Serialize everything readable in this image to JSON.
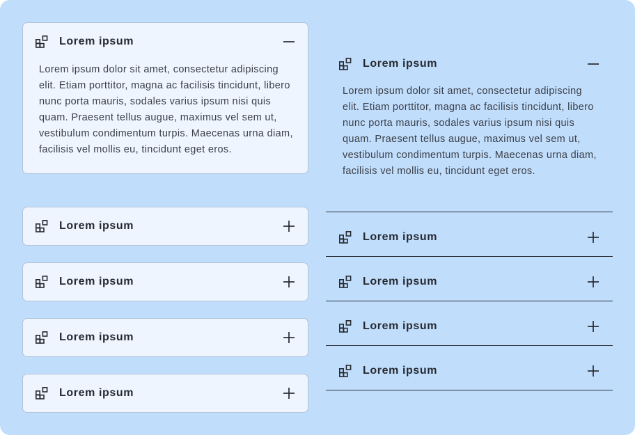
{
  "left_accordion": {
    "items": [
      {
        "title": "Lorem ipsum",
        "expanded": true,
        "toggle_icon": "minus-icon",
        "leading_icon": "widgets-icon",
        "content": "Lorem ipsum dolor sit amet, consectetur adipiscing elit. Etiam porttitor, magna ac facilisis tincidunt, libero nunc porta mauris, sodales varius ipsum nisi quis quam. Praesent tellus augue, maximus vel sem ut, vestibulum condimentum turpis. Maecenas urna diam, facilisis vel mollis eu, tincidunt eget eros."
      },
      {
        "title": "Lorem ipsum",
        "expanded": false,
        "toggle_icon": "plus-icon",
        "leading_icon": "widgets-icon"
      },
      {
        "title": "Lorem ipsum",
        "expanded": false,
        "toggle_icon": "plus-icon",
        "leading_icon": "widgets-icon"
      },
      {
        "title": "Lorem ipsum",
        "expanded": false,
        "toggle_icon": "plus-icon",
        "leading_icon": "widgets-icon"
      },
      {
        "title": "Lorem ipsum",
        "expanded": false,
        "toggle_icon": "plus-icon",
        "leading_icon": "widgets-icon"
      }
    ]
  },
  "right_accordion": {
    "items": [
      {
        "title": "Lorem ipsum",
        "expanded": true,
        "toggle_icon": "minus-icon",
        "leading_icon": "widgets-icon",
        "content": "Lorem ipsum dolor sit amet, consectetur adipiscing elit. Etiam porttitor, magna ac facilisis tincidunt, libero nunc porta mauris, sodales varius ipsum nisi quis quam. Praesent tellus augue, maximus vel sem ut, vestibulum condimentum turpis. Maecenas urna diam, facilisis vel mollis eu, tincidunt eget eros."
      },
      {
        "title": "Lorem ipsum",
        "expanded": false,
        "toggle_icon": "plus-icon",
        "leading_icon": "widgets-icon"
      },
      {
        "title": "Lorem ipsum",
        "expanded": false,
        "toggle_icon": "plus-icon",
        "leading_icon": "widgets-icon"
      },
      {
        "title": "Lorem ipsum",
        "expanded": false,
        "toggle_icon": "plus-icon",
        "leading_icon": "widgets-icon"
      },
      {
        "title": "Lorem ipsum",
        "expanded": false,
        "toggle_icon": "plus-icon",
        "leading_icon": "widgets-icon"
      }
    ]
  },
  "colors": {
    "page_background": "#c1ddfc",
    "card_background": "#eef5ff",
    "card_border": "#b2c3d8",
    "title_text": "#262a30",
    "body_text": "#3a3f46",
    "divider": "#2a3038"
  }
}
